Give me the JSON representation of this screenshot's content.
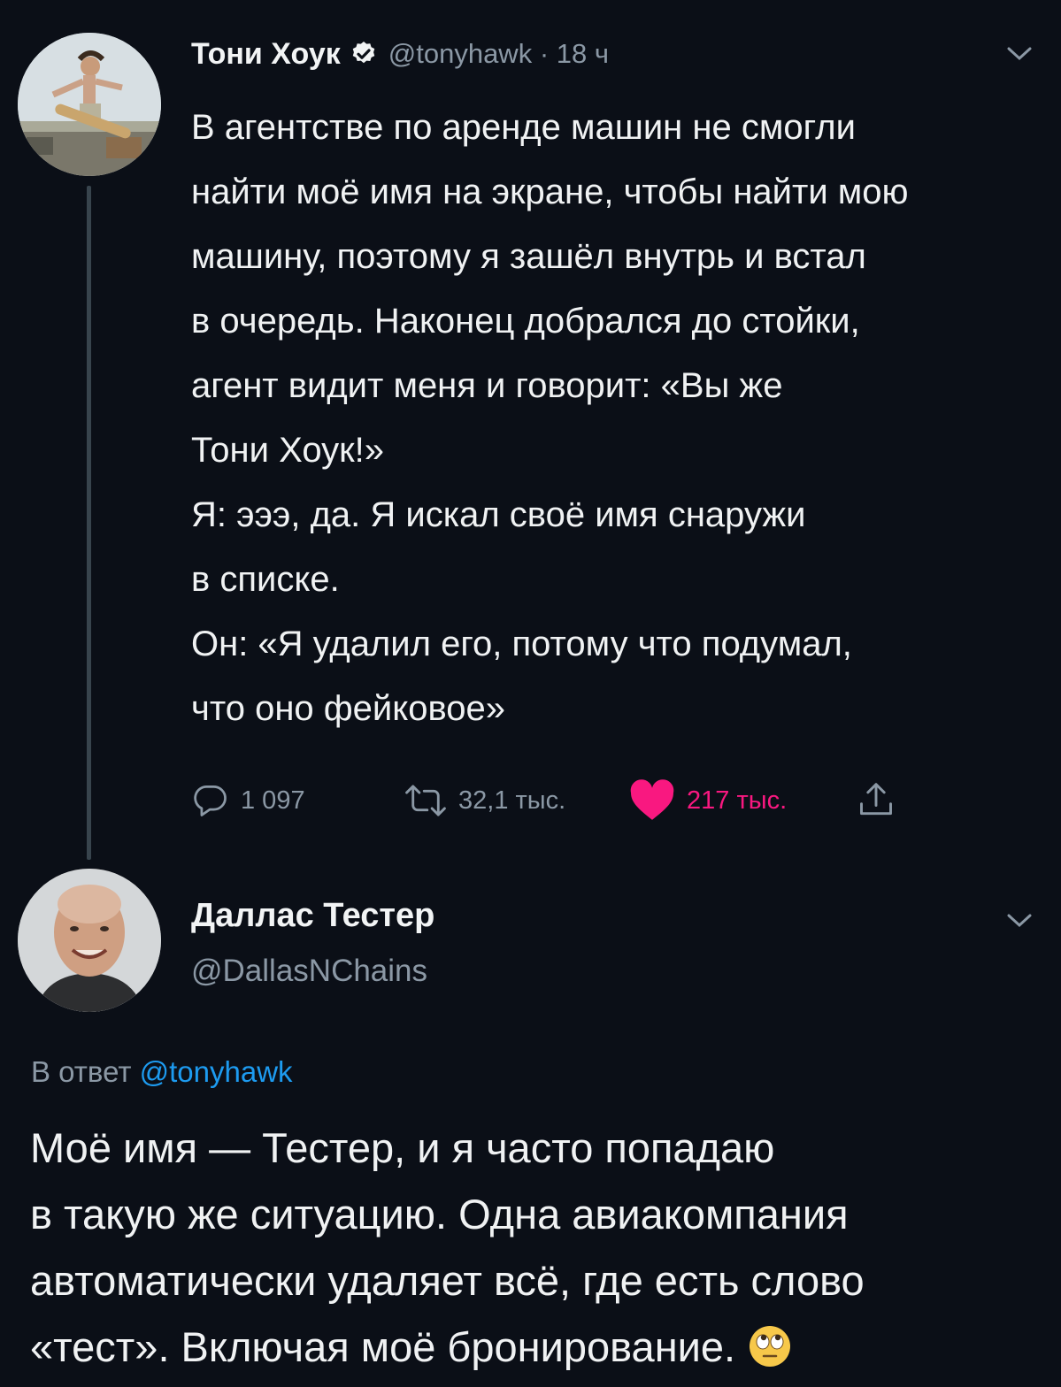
{
  "tweet": {
    "author_name": "Тони Хоук",
    "handle": "@tonyhawk",
    "time": "· 18 ч",
    "text_lines": [
      "В агентстве по аренде машин не смогли",
      "найти моё имя на экране, чтобы найти мою",
      "машину, поэтому я зашёл внутрь и встал",
      "в очередь. Наконец добрался до стойки,",
      "агент видит меня и говорит: «Вы же",
      "Тони Хоук!»",
      "Я: эээ, да. Я искал своё имя снаружи",
      "в списке.",
      "Он: «Я удалил его, потому что подумал,",
      "что оно фейковое»"
    ],
    "replies": "1 097",
    "retweets": "32,1 тыс.",
    "likes": "217 тыс."
  },
  "reply": {
    "author_name": "Даллас Тестер",
    "handle": "@DallasNChains",
    "reply_to_prefix": "В ответ",
    "reply_to_handle": "@tonyhawk",
    "text_lines": [
      "Моё имя — Тестер, и я часто попадаю",
      "в такую же ситуацию. Одна авиакомпания",
      "автоматически удаляет всё, где есть слово",
      "«тест». Включая моё бронирование."
    ],
    "emoji": "face-with-rolling-eyes"
  },
  "colors": {
    "background": "#0b0f17",
    "secondary_text": "#8b98a5",
    "like": "#f91880",
    "link": "#1d9bf0"
  },
  "icons": [
    "verified-icon",
    "chevron-down-icon",
    "reply-icon",
    "retweet-icon",
    "heart-icon",
    "share-icon"
  ]
}
